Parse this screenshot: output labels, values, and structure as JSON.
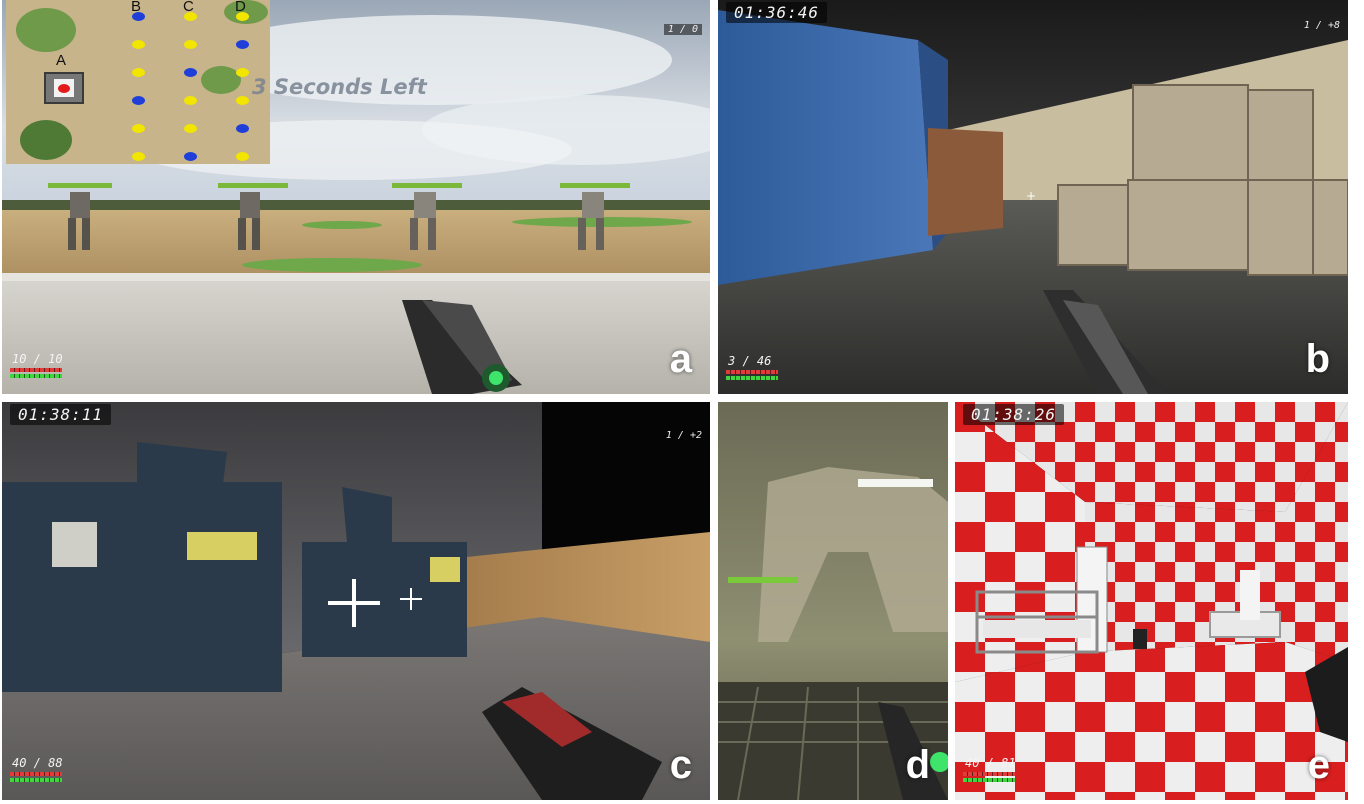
{
  "panels": {
    "a": {
      "label": "a",
      "score": "1 / 0",
      "countdown": "3 Seconds Left",
      "ammo": "10 / 10",
      "minimap": {
        "target_label": "A",
        "columns": [
          "B",
          "C",
          "D"
        ],
        "dots": {
          "B": [
            "blue",
            "yellow",
            "yellow",
            "blue",
            "yellow",
            "yellow"
          ],
          "C": [
            "yellow",
            "yellow",
            "blue",
            "yellow",
            "yellow",
            "blue"
          ],
          "D": [
            "yellow",
            "blue",
            "yellow",
            "yellow",
            "blue",
            "yellow"
          ]
        }
      }
    },
    "b": {
      "label": "b",
      "timer": "01:36:46",
      "score": "1 / +8",
      "ammo": "3 / 46"
    },
    "c": {
      "label": "c",
      "timer": "01:38:11",
      "score": "1 / +2",
      "ammo": "40 / 88"
    },
    "d": {
      "label": "d"
    },
    "e": {
      "label": "e",
      "timer": "01:38:26",
      "ammo": "40 / 81"
    }
  },
  "colors": {
    "blue_dot": "#1f3fd8",
    "yellow_dot": "#f2e600",
    "target_dot": "#e31b1b",
    "health": "#e23b3b",
    "armor": "#3fd63f"
  }
}
